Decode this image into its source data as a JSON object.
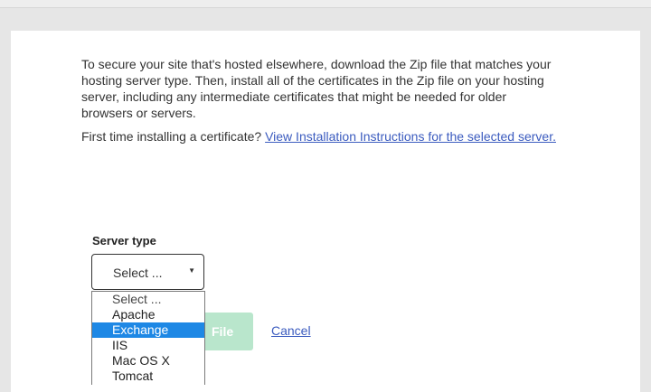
{
  "intro": {
    "text": "To secure your site that's hosted elsewhere, download the Zip file that matches your hosting server type. Then, install all of the certificates in the Zip file on your hosting server, including any intermediate certificates that might be needed for older browsers or servers."
  },
  "instructions": {
    "prefix": "First time installing a certificate?",
    "link_text": "View Installation Instructions for the selected server."
  },
  "server_type": {
    "label": "Server type",
    "selected_value": "Select ...",
    "options": [
      "Select ...",
      "Apache",
      "Exchange",
      "IIS",
      "Mac OS X",
      "Tomcat"
    ],
    "highlighted_option": "Exchange"
  },
  "actions": {
    "download_label_visible": "File",
    "cancel_label": "Cancel"
  },
  "colors": {
    "link": "#3b5bbf",
    "download_button": "#b9e6cc",
    "highlight": "#1e88e5"
  }
}
